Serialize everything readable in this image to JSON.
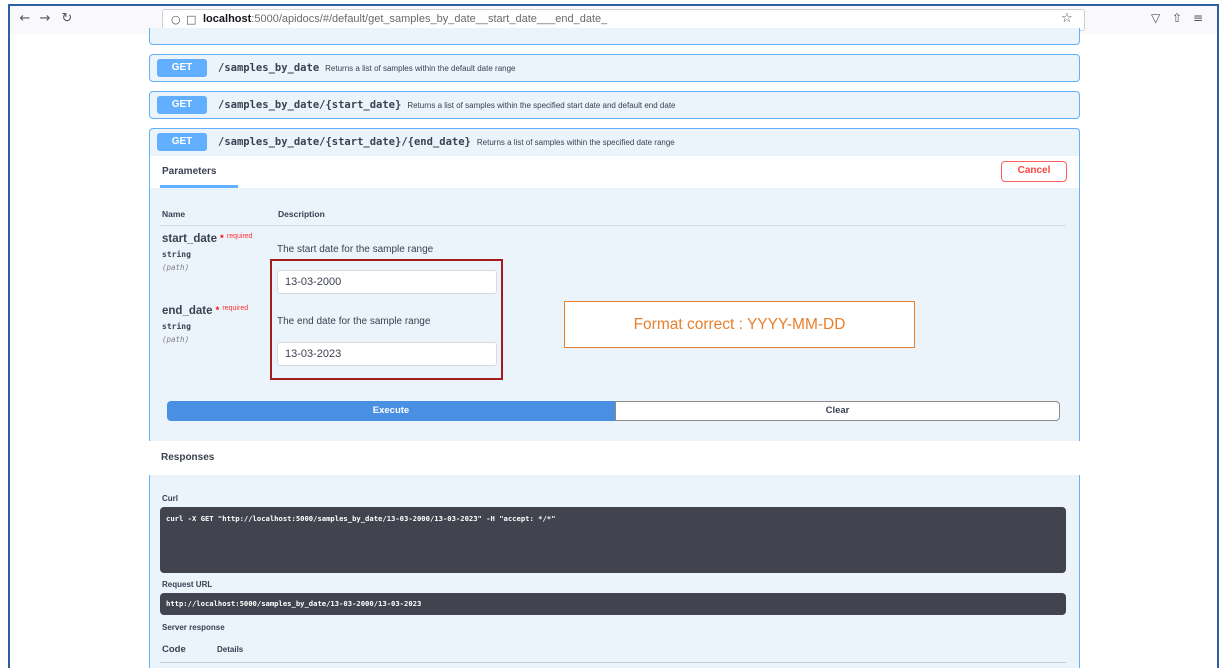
{
  "browser": {
    "url_prefix": "localhost",
    "url_rest": ":5000/apidocs/#/default/get_samples_by_date__start_date___end_date_"
  },
  "endpoints": [
    {
      "method": "GET",
      "path": "/samples_by_date",
      "description": "Returns a list of samples within the default date range"
    },
    {
      "method": "GET",
      "path": "/samples_by_date/{start_date}",
      "description": "Returns a list of samples within the specified start date and default end date"
    },
    {
      "method": "GET",
      "path": "/samples_by_date/{start_date}/{end_date}",
      "description": "Returns a list of samples within the specified date range"
    }
  ],
  "parameters_section": {
    "tab_label": "Parameters",
    "cancel_label": "Cancel",
    "col_name": "Name",
    "col_description": "Description",
    "params": [
      {
        "name": "start_date",
        "required_star": "*",
        "required_label": "required",
        "type": "string",
        "in": "(path)",
        "description": "The start date for the sample range",
        "value": "13-03-2000"
      },
      {
        "name": "end_date",
        "required_star": "*",
        "required_label": "required",
        "type": "string",
        "in": "(path)",
        "description": "The end date for the sample range",
        "value": "13-03-2023"
      }
    ]
  },
  "annotation": "Format correct : YYYY-MM-DD",
  "actions": {
    "execute_label": "Execute",
    "clear_label": "Clear"
  },
  "responses": {
    "title": "Responses",
    "curl_label": "Curl",
    "curl_command": "curl -X GET \"http://localhost:5000/samples_by_date/13-03-2000/13-03-2023\" -H \"accept: */*\"",
    "request_url_label": "Request URL",
    "request_url": "http://localhost:5000/samples_by_date/13-03-2000/13-03-2023",
    "server_response_label": "Server response",
    "code_label": "Code",
    "details_label": "Details"
  },
  "colors": {
    "get_method": "#61affe",
    "execute": "#4990e2",
    "cancel": "#ff6060",
    "highlight_box": "#a31d1d",
    "annotation": "#e87f2c",
    "code_bg": "#41444e"
  },
  "icons": {
    "back": "arrow-left-icon",
    "forward": "arrow-right-icon",
    "reload": "reload-icon",
    "shield": "shield-icon",
    "page": "page-icon",
    "bookmark": "star-icon",
    "pocket": "pocket-icon",
    "share": "share-icon",
    "menu": "hamburger-menu-icon"
  }
}
